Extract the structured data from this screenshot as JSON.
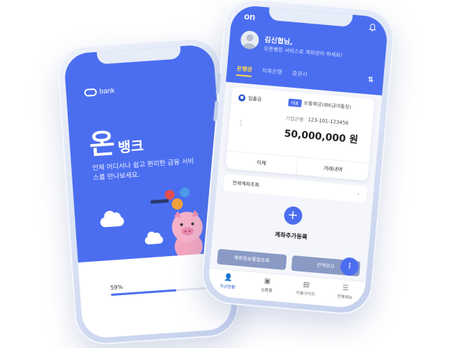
{
  "splash": {
    "logo_text": "bank",
    "title_big": "온",
    "title_small": "뱅크",
    "tagline": "언제 어디서나 쉽고 편리한 금융 서비스를 만나보세요.",
    "progress_label": "59%",
    "progress_value": 0.59
  },
  "app": {
    "logo": "on",
    "greeting_name": "김신협님,",
    "greeting_sub": "오픈뱅킹 서비스로 계좌관리 하세요!",
    "tabs": [
      {
        "label": "은행권",
        "active": true
      },
      {
        "label": "저축은행",
        "active": false
      },
      {
        "label": "증권사",
        "active": false
      }
    ],
    "account": {
      "type": "입출금",
      "badge": "대표",
      "product": "보통예금(IBK급여통장)",
      "bank": "기업은행",
      "number": "123-101-123456",
      "balance": "50,000,000 원",
      "actions": [
        "이체",
        "거래내역"
      ]
    },
    "all_accounts_label": "전체계좌조회",
    "add_label": "계좌추가등록",
    "bottom_buttons": [
      "계좌정보통합조회",
      "잔액모으"
    ],
    "tabbar": [
      {
        "label": "자산현황",
        "icon": "person-icon",
        "active": true
      },
      {
        "label": "상품몰",
        "icon": "gift-icon",
        "active": false
      },
      {
        "label": "이용가이드",
        "icon": "book-icon",
        "active": false
      },
      {
        "label": "전체메뉴",
        "icon": "menu-icon",
        "active": false
      }
    ]
  },
  "colors": {
    "primary": "#4b6ef0",
    "accent": "#ffd84a",
    "button_gray": "#8a9ac5"
  }
}
